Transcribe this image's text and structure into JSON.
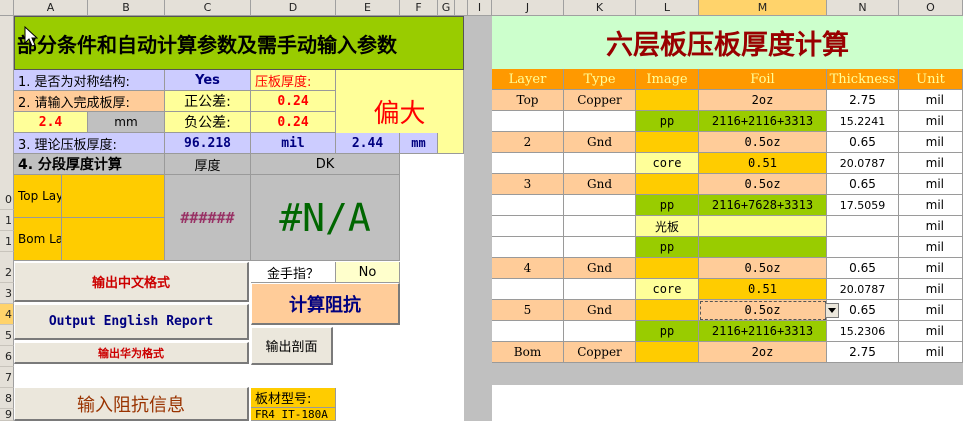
{
  "columns": {
    "left": [
      {
        "label": "A"
      },
      {
        "label": "B"
      },
      {
        "label": "C"
      },
      {
        "label": "D"
      },
      {
        "label": "E"
      },
      {
        "label": "F"
      },
      {
        "label": "G"
      }
    ],
    "right": [
      {
        "label": "I"
      },
      {
        "label": "J"
      },
      {
        "label": "K"
      },
      {
        "label": "L"
      },
      {
        "label": "M"
      },
      {
        "label": "N"
      },
      {
        "label": "O"
      }
    ]
  },
  "rows": [
    "",
    "",
    "",
    "",
    "",
    "",
    "",
    "",
    "",
    "0",
    "1",
    "2",
    "3",
    "4",
    "5",
    "6",
    "7",
    "8",
    "9"
  ],
  "left_panel": {
    "header_title": "部分条件和自动计算参数及需手动输入参数",
    "symmetric_label": "1. 是否为对称结构:",
    "symmetric_value": "Yes",
    "pressed_thickness_label": "压板厚度:",
    "deviation_text": "偏大",
    "finished_thickness_label": "2. 请输入完成板厚:",
    "pos_tol_label": "正公差:",
    "pos_tol_value": "0.24",
    "board_thickness_value": "2.4",
    "board_unit": "mm",
    "neg_tol_label": "负公差:",
    "neg_tol_value": "0.24",
    "theory_label": "3. 理论压板厚度:",
    "theory_value": "96.218",
    "theory_unit": "mil",
    "theory_mm_value": "2.44",
    "theory_mm_unit": "mm",
    "section_label": "4. 分段厚度计算",
    "thickness_col": "厚度",
    "dk_col": "DK",
    "top_layer_label": "Top Layer",
    "bom_layer_label": "Bom Layer",
    "hash_value": "######",
    "na_value": "#N/A",
    "gold_finger_label": "金手指？",
    "gold_finger_value": "No",
    "output_cn_button": "输出中文格式",
    "output_en_button": "Output English Report",
    "output_hw_button": "输出华为格式",
    "calc_impedance_button": "计算阻抗",
    "output_section_button": "输出剖面",
    "input_impedance_button": "输入阻抗信息",
    "board_model_label": "板材型号:",
    "board_model_value": "FR4 IT-180A"
  },
  "right_panel": {
    "title": "六层板压板厚度计算",
    "headers": [
      "Layer",
      "Type",
      "Image",
      "Foil",
      "Thickness",
      "Unit"
    ],
    "rows": [
      {
        "layer": "Top",
        "type": "Copper",
        "image": "",
        "foil": "2oz",
        "thickness": "2.75",
        "unit": "mil"
      },
      {
        "layer": "",
        "type": "",
        "image": "pp",
        "foil": "2116+2116+3313",
        "thickness": "15.2241",
        "unit": "mil"
      },
      {
        "layer": "2",
        "type": "Gnd",
        "image": "",
        "foil": "0.5oz",
        "thickness": "0.65",
        "unit": "mil"
      },
      {
        "layer": "",
        "type": "",
        "image": "core",
        "foil": "0.51",
        "thickness": "20.0787",
        "unit": "mil"
      },
      {
        "layer": "3",
        "type": "Gnd",
        "image": "",
        "foil": "0.5oz",
        "thickness": "0.65",
        "unit": "mil"
      },
      {
        "layer": "",
        "type": "",
        "image": "pp",
        "foil": "2116+7628+3313",
        "thickness": "17.5059",
        "unit": "mil"
      },
      {
        "layer": "",
        "type": "",
        "image": "光板",
        "foil": "",
        "thickness": "",
        "unit": "mil"
      },
      {
        "layer": "",
        "type": "",
        "image": "pp",
        "foil": "",
        "thickness": "",
        "unit": "mil"
      },
      {
        "layer": "4",
        "type": "Gnd",
        "image": "",
        "foil": "0.5oz",
        "thickness": "0.65",
        "unit": "mil"
      },
      {
        "layer": "",
        "type": "",
        "image": "core",
        "foil": "0.51",
        "thickness": "20.0787",
        "unit": "mil"
      },
      {
        "layer": "5",
        "type": "Gnd",
        "image": "",
        "foil": "0.5oz",
        "thickness": "0.65",
        "unit": "mil"
      },
      {
        "layer": "",
        "type": "",
        "image": "pp",
        "foil": "2116+2116+3313",
        "thickness": "15.2306",
        "unit": "mil"
      },
      {
        "layer": "Bom",
        "type": "Copper",
        "image": "",
        "foil": "2oz",
        "thickness": "2.75",
        "unit": "mil"
      }
    ]
  },
  "colors": {
    "header_green": "#99cc00",
    "orange": "#ffcc00",
    "salmon": "#ffcc99",
    "light_yellow": "#ffff99",
    "lavender": "#ccccff",
    "gray": "#c0c0c0",
    "dk_green": "#006600",
    "maroon": "#993366",
    "red": "#ff0000",
    "title_red": "#990000"
  }
}
